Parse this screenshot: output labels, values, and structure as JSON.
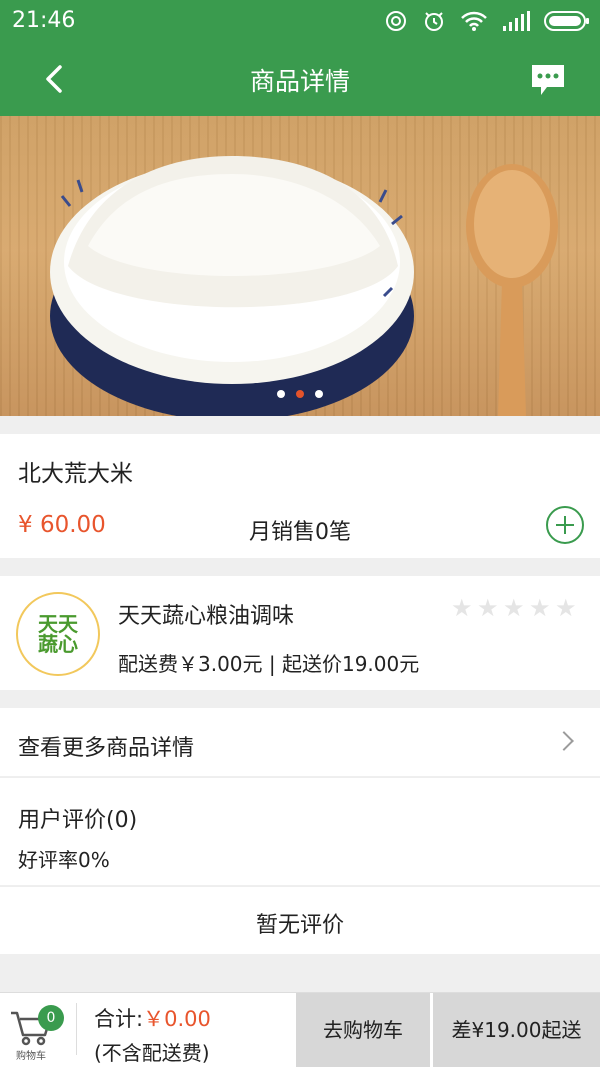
{
  "status_bar": {
    "time": "21:46",
    "icons": [
      "hotspot-icon",
      "alarm-icon",
      "wifi-icon",
      "signal-icon",
      "battery-icon"
    ]
  },
  "nav": {
    "title": "商品详情",
    "back_icon": "back-arrow-icon",
    "chat_icon": "chat-bubble-icon"
  },
  "carousel": {
    "slide_count": 3,
    "active_index": 1
  },
  "product": {
    "name": "北大荒大米",
    "price": "¥ 60.00",
    "monthly_sales": "月销售0笔"
  },
  "shop": {
    "name": "天天蔬心粮油调味",
    "logo_line1": "天天",
    "logo_line2": "蔬心",
    "meta": "配送费￥3.00元 | 起送价19.00元",
    "rating_stars": 0
  },
  "links": {
    "more_details": "查看更多商品详情"
  },
  "reviews": {
    "title": "用户评价(0)",
    "positive_rate": "好评率0%",
    "empty_text": "暂无评价"
  },
  "footer": {
    "cart_count": "0",
    "cart_caption": "购物车",
    "total_label": "合计:",
    "total_value": "￥0.00",
    "shipping_note": "(不含配送费)",
    "go_cart_label": "去购物车",
    "min_order_label": "差¥19.00起送"
  },
  "colors": {
    "brand_green": "#3a9b4e",
    "price_orange": "#e8552d"
  }
}
